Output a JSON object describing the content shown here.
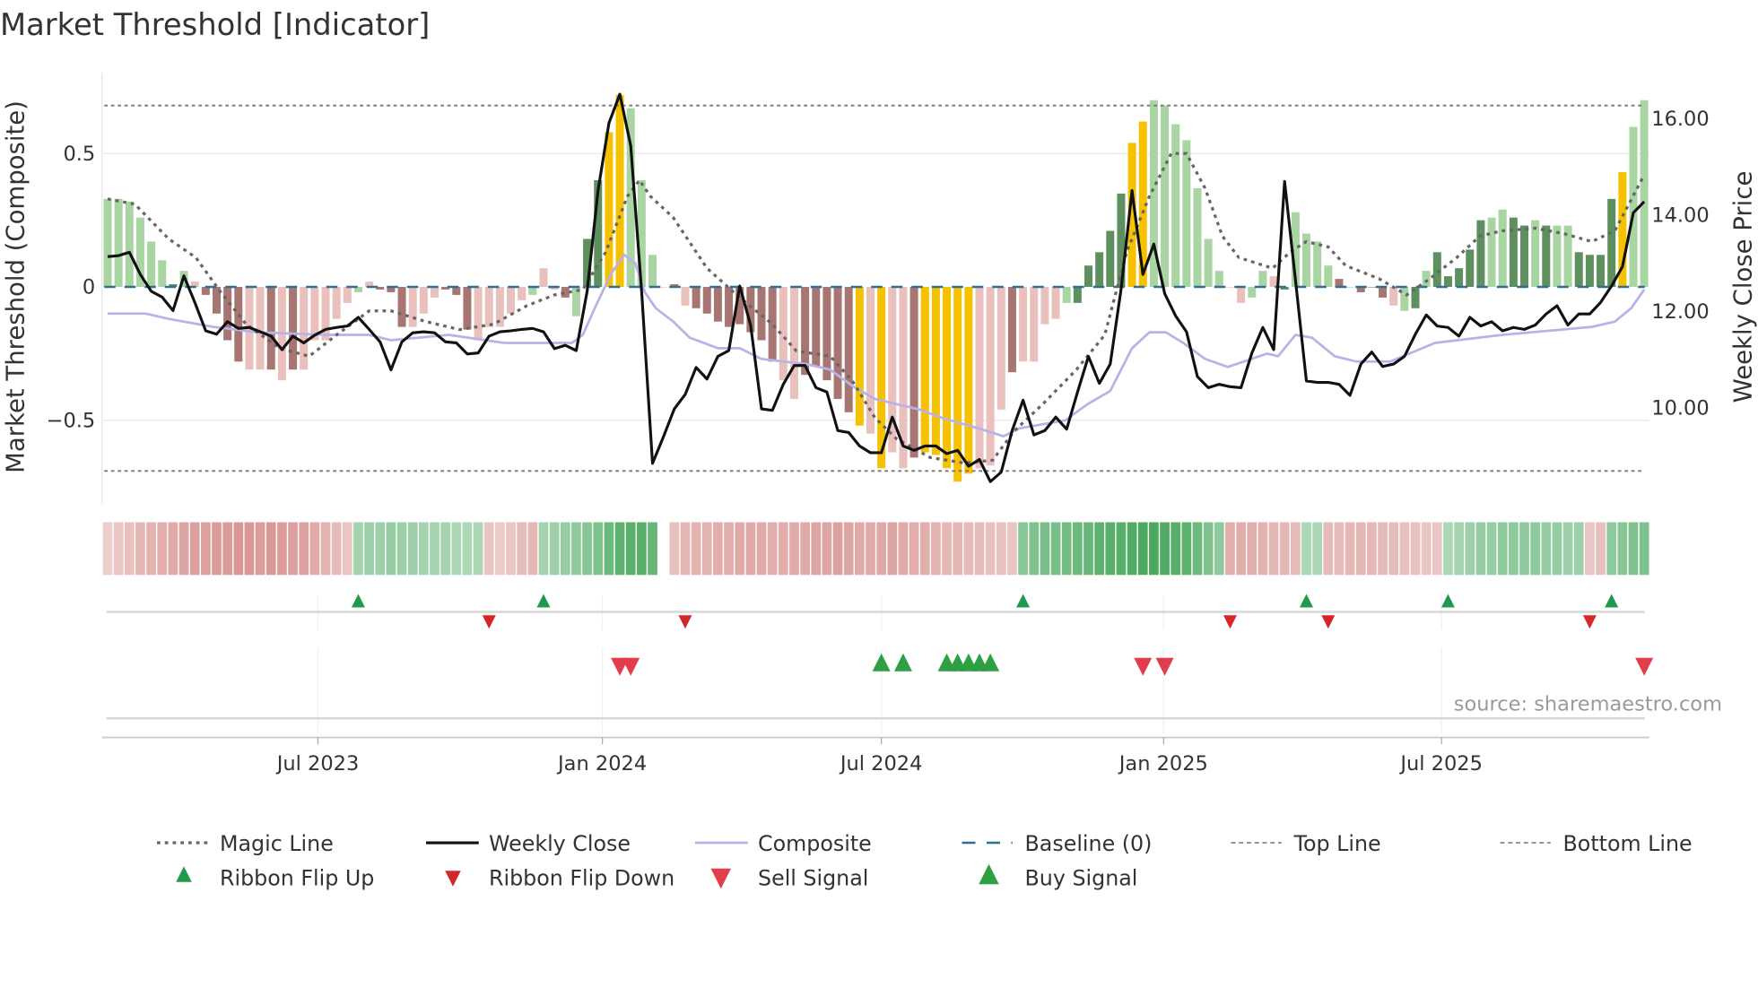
{
  "chart_data": {
    "type": "bar",
    "title": "Market Threshold [Indicator]",
    "ylabel": "Market Threshold (Composite)",
    "ylabel_right": "Weekly Close Price",
    "source": "source: sharemaestro.com",
    "ylim": [
      -0.8,
      0.8
    ],
    "ylim_right": [
      8.0,
      17.0
    ],
    "yticks": [
      {
        "v": 0.5,
        "label": "0.5"
      },
      {
        "v": 0,
        "label": "0"
      },
      {
        "v": -0.5,
        "label": "−0.5"
      }
    ],
    "yticks_right": [
      {
        "v": 16,
        "label": "16.00"
      },
      {
        "v": 14,
        "label": "14.00"
      },
      {
        "v": 12,
        "label": "12.00"
      },
      {
        "v": 10,
        "label": "10.00"
      }
    ],
    "xticks": [
      {
        "week": 19.3,
        "label": "Jul 2023"
      },
      {
        "week": 45.4,
        "label": "Jan 2024"
      },
      {
        "week": 71,
        "label": "Jul 2024"
      },
      {
        "week": 96.9,
        "label": "Jan 2025"
      },
      {
        "week": 122.4,
        "label": "Jul 2025"
      }
    ],
    "weeks": 142,
    "top_line": 0.68,
    "bottom_line": -0.69,
    "baseline": 0,
    "colors": {
      "G": "#5e8f5e",
      "g": "#a9d5a3",
      "R": "#a87672",
      "r": "#e9c0bc",
      "Y": "#f6c200",
      "magic": "#666666",
      "close": "#111111",
      "composite": "#b9b2e8",
      "baseline": "#2f6f96",
      "ribbon_up": "#38a04f",
      "ribbon_down": "#d0807c",
      "flip_up": "#1e9a4a",
      "flip_down": "#d62728",
      "buy": "#2ea043",
      "sell": "#e23d4b"
    },
    "composite_bars": [
      0.33,
      0.33,
      0.32,
      0.26,
      0.17,
      0.1,
      0.01,
      0.06,
      0.02,
      -0.03,
      -0.1,
      -0.2,
      -0.28,
      -0.31,
      -0.31,
      -0.31,
      -0.35,
      -0.31,
      -0.31,
      -0.2,
      -0.2,
      -0.12,
      -0.06,
      -0.02,
      0.02,
      -0.01,
      -0.02,
      -0.15,
      -0.15,
      -0.1,
      -0.04,
      -0.01,
      -0.03,
      -0.16,
      -0.2,
      -0.15,
      -0.15,
      -0.1,
      -0.05,
      -0.03,
      0.07,
      -0.01,
      -0.04,
      -0.11,
      0.18,
      0.4,
      0.58,
      0.72,
      0.67,
      0.4,
      0.12,
      0.0,
      0.01,
      -0.07,
      -0.08,
      -0.1,
      -0.13,
      -0.15,
      -0.14,
      -0.17,
      -0.2,
      -0.28,
      -0.35,
      -0.42,
      -0.33,
      -0.3,
      -0.35,
      -0.42,
      -0.47,
      -0.52,
      -0.55,
      -0.68,
      -0.62,
      -0.68,
      -0.64,
      -0.62,
      -0.63,
      -0.68,
      -0.73,
      -0.7,
      -0.68,
      -0.67,
      -0.46,
      -0.32,
      -0.28,
      -0.28,
      -0.14,
      -0.12,
      -0.06,
      -0.06,
      0.08,
      0.13,
      0.21,
      0.35,
      0.54,
      0.62,
      0.7,
      0.68,
      0.61,
      0.55,
      0.37,
      0.18,
      0.06,
      0.0,
      -0.06,
      -0.04,
      0.06,
      0.04,
      -0.01,
      0.28,
      0.2,
      0.17,
      0.08,
      0.03,
      0.0,
      -0.02,
      0.0,
      -0.04,
      -0.07,
      -0.09,
      -0.08,
      0.06,
      0.13,
      0.04,
      0.07,
      0.14,
      0.25,
      0.26,
      0.29,
      0.26,
      0.23,
      0.25,
      0.23,
      0.23,
      0.23,
      0.13,
      0.12,
      0.12,
      0.33,
      0.43,
      0.6,
      0.7
    ],
    "bar_color_keys": "ggggggGgrRRRRrrRrRrrrr",
    "bar_color_keys_2": "rgrRRRrrrRRRrrrrrgrrRgGGYYgggrRrRRR",
    "bar_color_keys_3": "RRRRRrrRRRRRYrYrrRYYYYYrrrRrrrrgGGGGGYYgggggggrrggrGggg",
    "bar_color_keys_4": "gRgRRRrgGgGGGGGggGGgGggGGGGY",
    "weekly_close": [
      13.14,
      13.16,
      13.23,
      12.77,
      12.42,
      12.3,
      12.02,
      12.74,
      12.19,
      11.6,
      11.53,
      11.79,
      11.65,
      11.67,
      11.58,
      11.49,
      11.21,
      11.49,
      11.35,
      11.51,
      11.63,
      11.67,
      11.7,
      11.88,
      11.63,
      11.37,
      10.79,
      11.37,
      11.56,
      11.58,
      11.56,
      11.37,
      11.35,
      11.12,
      11.14,
      11.49,
      11.58,
      11.6,
      11.63,
      11.65,
      11.58,
      11.23,
      11.3,
      11.19,
      12.42,
      14.51,
      15.91,
      16.51,
      15.44,
      12.42,
      8.85,
      9.4,
      9.98,
      10.28,
      10.84,
      10.6,
      11.07,
      11.19,
      12.53,
      11.72,
      9.98,
      9.95,
      10.49,
      10.88,
      10.88,
      10.42,
      10.33,
      9.53,
      9.49,
      9.21,
      9.07,
      9.07,
      9.81,
      9.21,
      9.12,
      9.21,
      9.21,
      9.05,
      9.12,
      8.79,
      8.93,
      8.47,
      8.67,
      9.53,
      10.16,
      9.44,
      9.53,
      9.81,
      9.56,
      10.33,
      11.07,
      10.51,
      10.91,
      12.47,
      14.51,
      12.77,
      13.4,
      12.37,
      11.91,
      11.58,
      10.65,
      10.42,
      10.49,
      10.44,
      10.42,
      11.14,
      11.67,
      11.21,
      14.7,
      12.65,
      10.56,
      10.53,
      10.53,
      10.49,
      10.26,
      10.91,
      11.16,
      10.86,
      10.91,
      11.07,
      11.53,
      11.93,
      11.7,
      11.67,
      11.49,
      11.88,
      11.7,
      11.79,
      11.6,
      11.67,
      11.63,
      11.72,
      11.95,
      12.12,
      11.72,
      11.95,
      11.95,
      12.19,
      12.53,
      12.93,
      14.05,
      14.28
    ],
    "magic_line": [
      [
        0,
        0.33
      ],
      [
        2.5,
        0.31
      ],
      [
        5.6,
        0.18
      ],
      [
        8.1,
        0.11
      ],
      [
        10.2,
        -0.01
      ],
      [
        12.7,
        -0.14
      ],
      [
        15.8,
        -0.23
      ],
      [
        18.5,
        -0.26
      ],
      [
        21,
        -0.18
      ],
      [
        24,
        -0.09
      ],
      [
        26,
        -0.09
      ],
      [
        29.2,
        -0.13
      ],
      [
        32.3,
        -0.16
      ],
      [
        35.4,
        -0.14
      ],
      [
        38.5,
        -0.07
      ],
      [
        41,
        -0.03
      ],
      [
        43.6,
        -0.01
      ],
      [
        45.7,
        0.13
      ],
      [
        47.7,
        0.34
      ],
      [
        48.8,
        0.4
      ],
      [
        49.8,
        0.34
      ],
      [
        51.9,
        0.26
      ],
      [
        55,
        0.07
      ],
      [
        58,
        -0.04
      ],
      [
        61,
        -0.14
      ],
      [
        63.2,
        -0.24
      ],
      [
        66.3,
        -0.26
      ],
      [
        68.3,
        -0.35
      ],
      [
        70.4,
        -0.49
      ],
      [
        72.4,
        -0.57
      ],
      [
        75.5,
        -0.64
      ],
      [
        78.6,
        -0.66
      ],
      [
        81.2,
        -0.65
      ],
      [
        83.2,
        -0.54
      ],
      [
        85.8,
        -0.44
      ],
      [
        88.9,
        -0.31
      ],
      [
        91.5,
        -0.18
      ],
      [
        93.5,
        0.13
      ],
      [
        95.6,
        0.34
      ],
      [
        97.6,
        0.5
      ],
      [
        99,
        0.5
      ],
      [
        100.7,
        0.37
      ],
      [
        102.3,
        0.19
      ],
      [
        103.8,
        0.11
      ],
      [
        106.9,
        0.07
      ],
      [
        108.5,
        0.13
      ],
      [
        110,
        0.17
      ],
      [
        112,
        0.15
      ],
      [
        113.6,
        0.08
      ],
      [
        116.7,
        0.03
      ],
      [
        119.2,
        -0.03
      ],
      [
        121.3,
        0.03
      ],
      [
        123.8,
        0.11
      ],
      [
        125.9,
        0.19
      ],
      [
        127.9,
        0.21
      ],
      [
        131,
        0.22
      ],
      [
        133.6,
        0.2
      ],
      [
        136.2,
        0.17
      ],
      [
        138.3,
        0.21
      ],
      [
        141,
        0.42
      ]
    ],
    "composite_line": [
      [
        0,
        -0.1
      ],
      [
        3.5,
        -0.1
      ],
      [
        5.6,
        -0.12
      ],
      [
        9.7,
        -0.15
      ],
      [
        13.8,
        -0.17
      ],
      [
        20,
        -0.18
      ],
      [
        24,
        -0.18
      ],
      [
        26,
        -0.2
      ],
      [
        31.3,
        -0.18
      ],
      [
        36.4,
        -0.21
      ],
      [
        42.6,
        -0.21
      ],
      [
        43.6,
        -0.18
      ],
      [
        44.7,
        -0.08
      ],
      [
        46.2,
        0.05
      ],
      [
        47.4,
        0.12
      ],
      [
        48.4,
        0.09
      ],
      [
        49.3,
        -0.02
      ],
      [
        50.3,
        -0.08
      ],
      [
        51.9,
        -0.13
      ],
      [
        53.4,
        -0.19
      ],
      [
        56,
        -0.23
      ],
      [
        58,
        -0.23
      ],
      [
        60,
        -0.27
      ],
      [
        64.2,
        -0.29
      ],
      [
        66.3,
        -0.31
      ],
      [
        68.3,
        -0.37
      ],
      [
        70.4,
        -0.42
      ],
      [
        74.5,
        -0.46
      ],
      [
        76.5,
        -0.49
      ],
      [
        80.7,
        -0.54
      ],
      [
        82.2,
        -0.56
      ],
      [
        83.7,
        -0.53
      ],
      [
        87.9,
        -0.5
      ],
      [
        89.9,
        -0.44
      ],
      [
        92,
        -0.39
      ],
      [
        93,
        -0.31
      ],
      [
        94,
        -0.23
      ],
      [
        95.6,
        -0.17
      ],
      [
        97.1,
        -0.17
      ],
      [
        98.7,
        -0.21
      ],
      [
        100.7,
        -0.27
      ],
      [
        102.8,
        -0.3
      ],
      [
        106.4,
        -0.25
      ],
      [
        107.4,
        -0.26
      ],
      [
        109,
        -0.18
      ],
      [
        110.5,
        -0.19
      ],
      [
        112.6,
        -0.26
      ],
      [
        114.6,
        -0.28
      ],
      [
        117.7,
        -0.28
      ],
      [
        121.8,
        -0.21
      ],
      [
        128,
        -0.18
      ],
      [
        136.2,
        -0.15
      ],
      [
        138.3,
        -0.13
      ],
      [
        139.8,
        -0.08
      ],
      [
        141,
        -0.01
      ]
    ],
    "ribbon": [
      -0.2,
      -0.3,
      -0.35,
      -0.45,
      -0.5,
      -0.55,
      -0.6,
      -0.65,
      -0.7,
      -0.7,
      -0.75,
      -0.75,
      -0.8,
      -0.8,
      -0.75,
      -0.8,
      -0.75,
      -0.7,
      -0.7,
      -0.6,
      -0.5,
      -0.4,
      -0.3,
      0.3,
      0.35,
      0.35,
      0.4,
      0.35,
      0.35,
      0.3,
      0.3,
      0.3,
      0.25,
      0.25,
      0.25,
      -0.3,
      -0.25,
      -0.3,
      -0.4,
      -0.45,
      0.3,
      0.35,
      0.4,
      0.45,
      0.5,
      0.55,
      0.7,
      0.8,
      0.85,
      0.85,
      0.75,
      null,
      -0.35,
      -0.45,
      -0.5,
      -0.5,
      -0.55,
      -0.55,
      -0.6,
      -0.6,
      -0.6,
      -0.55,
      -0.55,
      -0.6,
      -0.6,
      -0.65,
      -0.65,
      -0.7,
      -0.65,
      -0.6,
      -0.6,
      -0.6,
      -0.65,
      -0.6,
      -0.55,
      -0.55,
      -0.5,
      -0.45,
      -0.45,
      -0.4,
      -0.4,
      -0.35,
      -0.35,
      -0.3,
      0.5,
      0.55,
      0.6,
      0.6,
      0.65,
      0.7,
      0.75,
      0.8,
      0.85,
      0.85,
      0.9,
      0.95,
      0.95,
      0.9,
      0.85,
      0.8,
      0.7,
      0.55,
      0.45,
      -0.55,
      -0.55,
      -0.55,
      -0.5,
      -0.45,
      -0.45,
      -0.4,
      0.25,
      0.25,
      -0.4,
      -0.4,
      -0.45,
      -0.45,
      -0.45,
      -0.4,
      -0.4,
      -0.35,
      -0.35,
      -0.3,
      -0.3,
      0.25,
      0.3,
      0.35,
      0.4,
      0.4,
      0.45,
      0.45,
      0.45,
      0.45,
      0.4,
      0.4,
      0.35,
      0.35,
      -0.3,
      -0.35,
      0.45,
      0.5,
      0.55,
      0.55
    ],
    "ribbon_flip_up": [
      23,
      40,
      84,
      110,
      123,
      138
    ],
    "ribbon_flip_down": [
      35,
      53,
      103,
      112,
      136
    ],
    "buy_signals": [
      71,
      73,
      77,
      78,
      79,
      80,
      81
    ],
    "sell_signals": [
      47,
      48,
      95,
      97,
      141
    ],
    "legend": [
      {
        "label": "Magic Line",
        "kind": "dotted"
      },
      {
        "label": "Weekly Close",
        "kind": "solid-black"
      },
      {
        "label": "Composite",
        "kind": "solid-purple"
      },
      {
        "label": "Baseline (0)",
        "kind": "dashed-blue"
      },
      {
        "label": "Top Line",
        "kind": "dashed-gray"
      },
      {
        "label": "Bottom Line",
        "kind": "dashed-gray"
      },
      {
        "label": "Ribbon Flip Up",
        "kind": "tri-up-small"
      },
      {
        "label": "Ribbon Flip Down",
        "kind": "tri-down-small"
      },
      {
        "label": "Sell Signal",
        "kind": "tri-down-large"
      },
      {
        "label": "Buy Signal",
        "kind": "tri-up-large"
      }
    ],
    "legend_placement": "bottom"
  }
}
